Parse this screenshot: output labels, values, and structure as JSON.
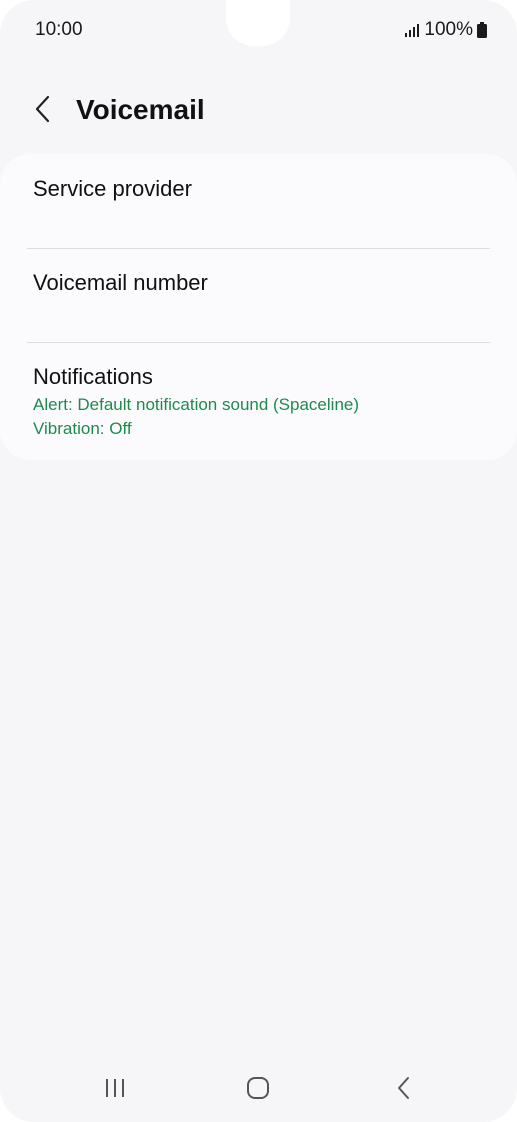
{
  "status_bar": {
    "time": "10:00",
    "battery": "100%",
    "signal_icon": "signal-bars-icon",
    "battery_icon": "battery-icon"
  },
  "header": {
    "title": "Voicemail",
    "back_icon": "chevron-left-icon"
  },
  "settings": {
    "items": [
      {
        "title": "Service provider"
      },
      {
        "title": "Voicemail number"
      },
      {
        "title": "Notifications",
        "subtitle_1": "Alert: Default notification sound (Spaceline)",
        "subtitle_2": "Vibration: Off"
      }
    ]
  },
  "nav_bar": {
    "recents_icon": "recent-apps-icon",
    "home_icon": "home-icon",
    "back_icon": "back-icon"
  },
  "colors": {
    "accent_green": "#1f8a4c",
    "background": "#f6f6f8",
    "card": "#fbfbfd"
  }
}
